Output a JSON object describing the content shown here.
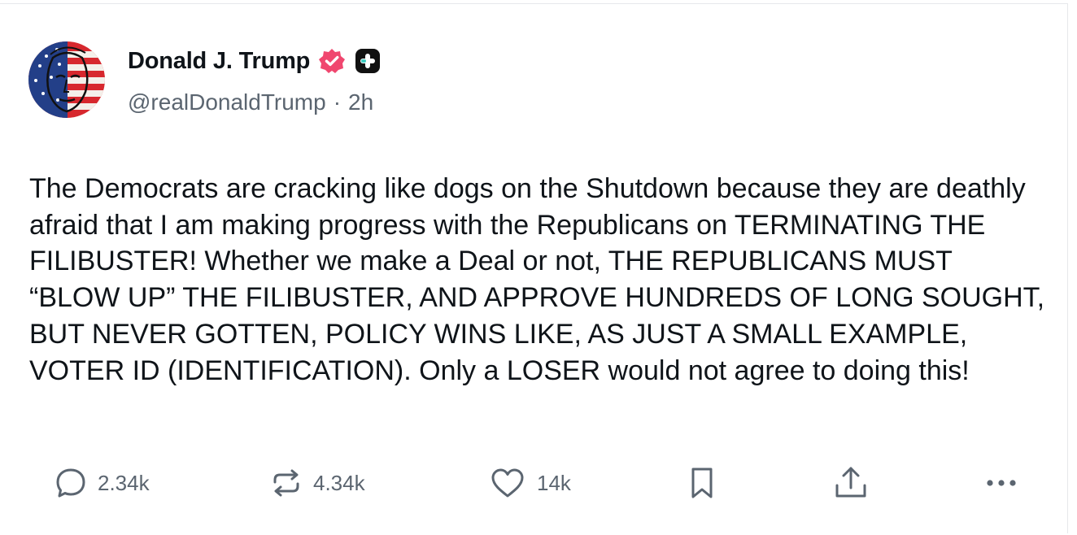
{
  "post": {
    "author": {
      "name": "Donald J. Trump",
      "handle": "@realDonaldTrump",
      "separator": "·",
      "timestamp": "2h",
      "avatar_icon": "flag-face-avatar",
      "verified_icon": "verified-badge-icon",
      "extra_badge_icon": "plus-badge-icon",
      "verified_color": "#f0476f"
    },
    "text": "The Democrats are cracking like dogs on the Shutdown because they are deathly afraid that I am making progress with the Republicans on TERMINATING THE FILIBUSTER! Whether we make a Deal or not, THE REPUBLICANS MUST “BLOW UP” THE FILIBUSTER, AND APPROVE HUNDREDS OF LONG SOUGHT, BUT NEVER GOTTEN, POLICY WINS LIKE, AS JUST A SMALL EXAMPLE, VOTER ID (IDENTIFICATION). Only a LOSER would not agree to doing this!",
    "actions": {
      "replies": "2.34k",
      "reposts": "4.34k",
      "likes": "14k",
      "icons": [
        "reply-icon",
        "repost-icon",
        "like-icon",
        "bookmark-icon",
        "share-icon",
        "more-icon"
      ]
    }
  },
  "colors": {
    "text": "#0f1419",
    "muted": "#5b6570",
    "border": "#e6e8eb"
  }
}
